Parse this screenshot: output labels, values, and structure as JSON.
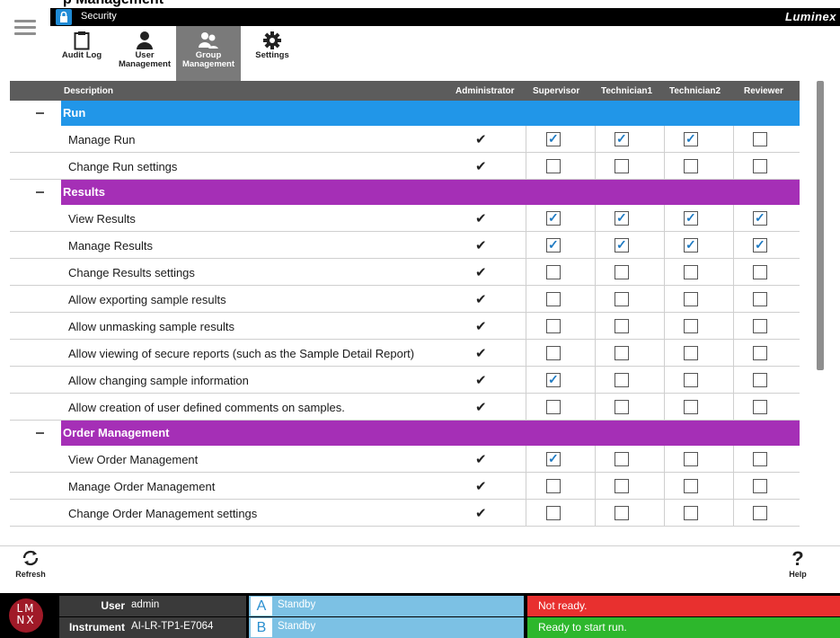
{
  "window": {
    "title": "Security",
    "brand": "Luminex",
    "caption": "p Management"
  },
  "toolbar": {
    "items": [
      {
        "label": "Audit Log",
        "icon": "clipboard-icon"
      },
      {
        "label": "User Management",
        "icon": "user-icon"
      },
      {
        "label": "Group Management",
        "icon": "group-icon"
      },
      {
        "label": "Settings",
        "icon": "gear-icon"
      }
    ],
    "active": "Group Management"
  },
  "table": {
    "columns": [
      "Description",
      "Administrator",
      "Supervisor",
      "Technician1",
      "Technician2",
      "Reviewer"
    ],
    "groups": [
      {
        "name": "Run",
        "color": "#2196e8",
        "rows": [
          {
            "label": "Manage Run",
            "perm": [
              true,
              true,
              true,
              false
            ]
          },
          {
            "label": "Change Run settings",
            "perm": [
              false,
              false,
              false,
              false
            ]
          }
        ]
      },
      {
        "name": "Results",
        "color": "#a52fb6",
        "rows": [
          {
            "label": "View Results",
            "perm": [
              true,
              true,
              true,
              true
            ]
          },
          {
            "label": "Manage Results",
            "perm": [
              true,
              true,
              true,
              true
            ]
          },
          {
            "label": "Change Results settings",
            "perm": [
              false,
              false,
              false,
              false
            ]
          },
          {
            "label": "Allow exporting sample results",
            "perm": [
              false,
              false,
              false,
              false
            ]
          },
          {
            "label": "Allow unmasking sample results",
            "perm": [
              false,
              false,
              false,
              false
            ]
          },
          {
            "label": "Allow viewing of secure reports (such as the Sample Detail Report)",
            "perm": [
              false,
              false,
              false,
              false
            ]
          },
          {
            "label": "Allow changing sample information",
            "perm": [
              true,
              false,
              false,
              false
            ]
          },
          {
            "label": "Allow creation of user defined comments on samples.",
            "perm": [
              false,
              false,
              false,
              false
            ]
          }
        ]
      },
      {
        "name": "Order Management",
        "color": "#a52fb6",
        "rows": [
          {
            "label": "View Order Management",
            "perm": [
              true,
              false,
              false,
              false
            ]
          },
          {
            "label": "Manage Order Management",
            "perm": [
              false,
              false,
              false,
              false
            ]
          },
          {
            "label": "Change Order Management settings",
            "perm": [
              false,
              false,
              false,
              false
            ]
          }
        ]
      }
    ]
  },
  "footer": {
    "refresh_label": "Refresh",
    "help_label": "Help",
    "help_glyph": "?"
  },
  "status": {
    "user_key": "User",
    "user_value": "admin",
    "instrument_key": "Instrument",
    "instrument_value": "AI-LR-TP1-E7064",
    "slot_a": {
      "letter": "A",
      "text": "Standby"
    },
    "slot_b": {
      "letter": "B",
      "text": "Standby"
    },
    "status_1": {
      "text": "Not ready.",
      "color": "#e8302f"
    },
    "status_2": {
      "text": "Ready to start run.",
      "color": "#2db72c"
    },
    "logo_text": "LMNX"
  }
}
